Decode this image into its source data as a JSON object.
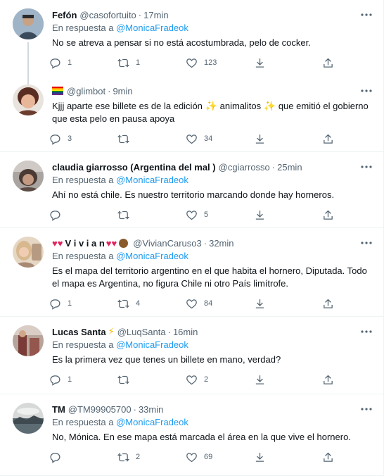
{
  "tweets": [
    {
      "name": "Fefón",
      "handle": "@casofortuito",
      "time": "17min",
      "reply_prefix": "En respuesta a",
      "reply_mention": "@MonicaFradeok",
      "text": "No se atreva a pensar si no está acostumbrada, pelo de cocker.",
      "replies": "1",
      "retweets": "1",
      "likes": "123",
      "avatar_color": "#6f8aa6"
    },
    {
      "name": "",
      "handle": "@glimbot",
      "time": "9min",
      "text_a": "Kjjj aparte ese billete es de la edición",
      "text_b": "animalitos",
      "text_c": "que emitió el gobierno que esta pelo en pausa apoya",
      "replies": "3",
      "retweets": "",
      "likes": "34",
      "avatar_color": "#6b3d2e"
    },
    {
      "name": "claudia giarrosso (Argentina del mal )",
      "handle": "@cgiarrosso",
      "time": "25min",
      "text": "Ahí no está chile. Es nuestro territorio marcando donde hay horneros.",
      "replies": "",
      "retweets": "",
      "likes": "5",
      "avatar_color": "#5c4a44"
    },
    {
      "name_text": "V i v i a n",
      "handle": "@VivianCaruso3",
      "time": "32min",
      "reply_prefix": "En respuesta a",
      "reply_mention": "@MonicaFradeok",
      "text": "Es el mapa del territorio argentino en el que habita el hornero, Diputada. Todo el mapa es Argentina, no figura Chile ni otro País limítrofe.",
      "replies": "1",
      "retweets": "4",
      "likes": "84",
      "avatar_color": "#c9a98c"
    },
    {
      "name": "Lucas Santa",
      "handle": "@LuqSanta",
      "time": "16min",
      "reply_prefix": "En respuesta a",
      "reply_mention": "@MonicaFradeok",
      "text": "Es la primera vez que tenes un billete en mano, verdad?",
      "replies": "1",
      "retweets": "",
      "likes": "2",
      "avatar_color": "#7a3b36"
    },
    {
      "name": "TM",
      "handle": "@TM99905700",
      "time": "33min",
      "reply_prefix": "En respuesta a",
      "reply_mention": "@MonicaFradeok",
      "text": "No, Mónica. En ese mapa está marcada el área en la que vive el hornero.",
      "replies": "",
      "retweets": "2",
      "likes": "69",
      "avatar_color": "#5d6b73"
    }
  ],
  "symbols": {
    "dot": "·",
    "sparkle": "✨",
    "heart": "♥",
    "bolt": "⚡"
  },
  "icons": [
    "reply-icon",
    "retweet-icon",
    "like-icon",
    "share-icon",
    "more-icon"
  ],
  "colors": {
    "link": "#1d9bf0",
    "secondary": "#536471",
    "text": "#0f1419",
    "divider": "#eff3f4"
  }
}
